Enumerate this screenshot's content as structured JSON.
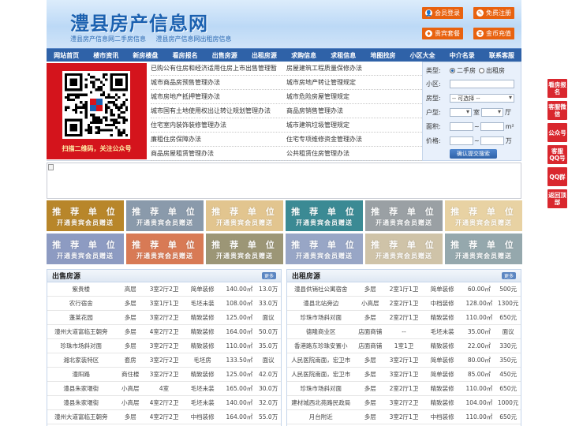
{
  "header": {
    "logo": "澧县房产信息网",
    "subtitle_1": "澧县房产信息网二手房信息",
    "subtitle_2": "澧县房产信息网出租房信息",
    "buttons": [
      {
        "label": "会员登录",
        "icon": "user-icon",
        "symbol": "👤"
      },
      {
        "label": "免费注册",
        "icon": "register-icon",
        "symbol": "✎"
      },
      {
        "label": "贵宾套餐",
        "icon": "vip-icon",
        "symbol": "♦"
      },
      {
        "label": "金币充值",
        "icon": "coin-icon",
        "symbol": "¥"
      }
    ]
  },
  "nav": [
    "网站首页",
    "楼市资讯",
    "新房楼盘",
    "看房报名",
    "出售房源",
    "出租房源",
    "求购信息",
    "求租信息",
    "地图找房",
    "小区大全",
    "中介名录",
    "联系客服"
  ],
  "qr": {
    "caption": "扫描二维码，关注公众号"
  },
  "links": [
    [
      "已购公有住房和经济适用住房上市出售管理暂",
      "房屋建筑工程质量保修办法"
    ],
    [
      "城市商品房预售管理办法",
      "城市房地产转让管理规定"
    ],
    [
      "城市房地产抵押管理办法",
      "城市危险房屋管理规定"
    ],
    [
      "城市国有土地使用权出让转让规划管理办法",
      "商品房销售管理办法"
    ],
    [
      "住宅室内装饰装修管理办法",
      "城市建筑垃圾管理规定"
    ],
    [
      "廉租住房保障办法",
      "住宅专项维修资金管理办法"
    ],
    [
      "商品房屋租赁管理办法",
      "公共租赁住房管理办法"
    ]
  ],
  "search": {
    "type_label": "类型:",
    "type_options": [
      "二手房",
      "出租房"
    ],
    "community_label": "小区:",
    "community_value": "",
    "house_type_label": "房型:",
    "house_type_value": "-- 可选择 --",
    "layout_label": "户型:",
    "layout_room": "室",
    "layout_hall": "厅",
    "area_label": "面积:",
    "area_unit": "m²",
    "price_label": "价格:",
    "price_unit": "万",
    "range_sep": "~",
    "submit": "确认提交搜索"
  },
  "ads": {
    "title": "推 荐 单 位",
    "sub": "开通贵宾会员赠送",
    "colors": [
      "#b8862a",
      "#8a9aab",
      "#e2c58f",
      "#3b8a94",
      "#9aa0a4",
      "#e8d2a3",
      "#8d9bc2",
      "#d87a55",
      "#9c9676",
      "#98a6c6",
      "#cfc3a8",
      "#95a8ad"
    ]
  },
  "sale": {
    "title": "出售房源",
    "more": "更多",
    "rows": [
      [
        "紫贵楼",
        "高层",
        "3室2厅2卫",
        "简单装修",
        "140.00㎡",
        "13.0万"
      ],
      [
        "农行宿舍",
        "多层",
        "3室1厅1卫",
        "毛坯未装",
        "108.00㎡",
        "33.0万"
      ],
      [
        "蓬莱花园",
        "多层",
        "3室2厅2卫",
        "精致装修",
        "125.00㎡",
        "面议"
      ],
      [
        "澧州大道富临王朝旁",
        "多层",
        "4室2厅2卫",
        "精致装修",
        "164.00㎡",
        "50.0万"
      ],
      [
        "珍珠市场斜对面",
        "多层",
        "3室2厅2卫",
        "精致装修",
        "110.00㎡",
        "35.0万"
      ],
      [
        "湘北家装特区",
        "套房",
        "3室2厅2卫",
        "毛坯房",
        "133.50㎡",
        "面议"
      ],
      [
        "澧阳路",
        "商住楼",
        "3室2厅2卫",
        "精致装修",
        "125.00㎡",
        "42.0万"
      ],
      [
        "澧县朱家堰街",
        "小高层",
        "4室",
        "毛坯未装",
        "165.00㎡",
        "30.0万"
      ],
      [
        "澧县朱家堰街",
        "小高层",
        "4室2厅2卫",
        "毛坯未装",
        "140.00㎡",
        "32.0万"
      ],
      [
        "澧州大道富临王朝旁",
        "多层",
        "4室2厅2卫",
        "中档装修",
        "164.00㎡",
        "55.0万"
      ]
    ]
  },
  "rent": {
    "title": "出租房源",
    "more": "更多",
    "rows": [
      [
        "澧县供销社公寓宿舍",
        "多层",
        "2室1厅1卫",
        "简单装修",
        "60.00㎡",
        "500元"
      ],
      [
        "澧县北站旁边",
        "小高层",
        "2室2厅1卫",
        "中档装修",
        "128.00㎡",
        "1300元"
      ],
      [
        "珍珠市场斜对面",
        "多层",
        "2室2厅1卫",
        "精致装修",
        "110.00㎡",
        "650元"
      ],
      [
        "德隆商业区",
        "店面商铺",
        "--",
        "毛坯未装",
        "35.00㎡",
        "面议"
      ],
      [
        "香港路东珍珠安置小",
        "店面商铺",
        "1室1卫",
        "精致装修",
        "22.00㎡",
        "330元"
      ],
      [
        "人民医院南面，宏卫市",
        "多层",
        "3室2厅1卫",
        "简单装修",
        "80.00㎡",
        "350元"
      ],
      [
        "人民医院南面，宏卫市",
        "多层",
        "3室2厅1卫",
        "简单装修",
        "85.00㎡",
        "450元"
      ],
      [
        "珍珠市场斜对面",
        "多层",
        "2室2厅1卫",
        "精致装修",
        "110.00㎡",
        "650元"
      ],
      [
        "建材城西北苑路民政局",
        "多层",
        "3室2厅2卫",
        "精致装修",
        "104.00㎡",
        "1000元"
      ],
      [
        "月台附近",
        "多层",
        "3室2厅1卫",
        "中档装修",
        "110.00㎡",
        "650元"
      ]
    ]
  },
  "floaters": [
    "看房报名",
    "客服微信",
    "公众号",
    "客服QQ号",
    "QQ群",
    "返回顶部"
  ]
}
